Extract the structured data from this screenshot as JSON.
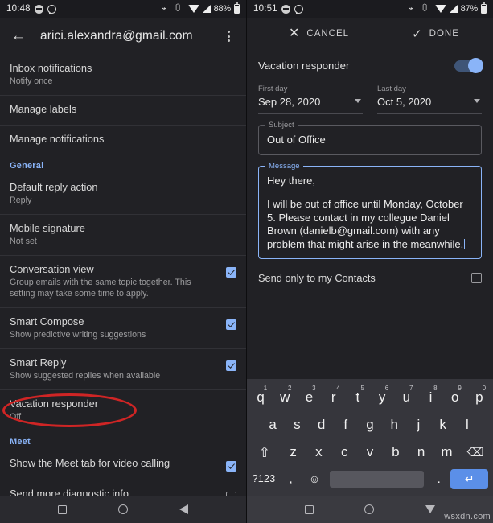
{
  "left": {
    "status": {
      "time": "10:48",
      "battery": "88%",
      "icons": [
        "message-dot-icon",
        "whatsapp-icon",
        "bluetooth-icon",
        "vibrate-icon",
        "wifi-icon",
        "signal-icon",
        "battery-icon"
      ]
    },
    "appbar": {
      "back": "back-arrow",
      "title": "arici.alexandra@gmail.com",
      "overflow": "more-options"
    },
    "rows": [
      {
        "title": "Inbox notifications",
        "subtitle": "Notify once",
        "checkbox": "none",
        "divider": false
      },
      {
        "title": "Manage labels",
        "subtitle": "",
        "checkbox": "none",
        "divider": true
      },
      {
        "title": "Manage notifications",
        "subtitle": "",
        "checkbox": "none",
        "divider": true
      },
      {
        "title": "Default reply action",
        "subtitle": "Reply",
        "checkbox": "none",
        "divider": false
      },
      {
        "title": "Mobile signature",
        "subtitle": "Not set",
        "checkbox": "none",
        "divider": true
      },
      {
        "title": "Conversation view",
        "subtitle": "Group emails with the same topic together. This setting may take some time to apply.",
        "checkbox": "checked",
        "divider": true
      },
      {
        "title": "Smart Compose",
        "subtitle": "Show predictive writing suggestions",
        "checkbox": "checked",
        "divider": true
      },
      {
        "title": "Smart Reply",
        "subtitle": "Show suggested replies when available",
        "checkbox": "checked",
        "divider": true
      },
      {
        "title": "Vacation responder",
        "subtitle": "Off",
        "checkbox": "none",
        "divider": true
      }
    ],
    "section_general": "General",
    "section_meet": "Meet",
    "meet_row": {
      "title": "Show the Meet tab for video calling",
      "checkbox": "checked"
    },
    "diagnostic_row": {
      "title": "Send more diagnostic info",
      "checkbox": "empty"
    },
    "annotation": {
      "shape": "red-ellipse",
      "color": "#cf2525",
      "target": "Vacation responder"
    },
    "nav": [
      "recents-square",
      "home-circle",
      "back-triangle"
    ]
  },
  "right": {
    "status": {
      "time": "10:51",
      "battery": "87%"
    },
    "actionbar": {
      "cancel": "CANCEL",
      "done": "DONE"
    },
    "vacation": {
      "label": "Vacation responder",
      "toggle_state": "on",
      "toggle_color": "#8ab4f8"
    },
    "first_day": {
      "caption": "First day",
      "value": "Sep 28, 2020"
    },
    "last_day": {
      "caption": "Last day",
      "value": "Oct 5, 2020"
    },
    "subject": {
      "legend": "Subject",
      "value": "Out of Office",
      "focused": false
    },
    "message": {
      "legend": "Message",
      "focused": true,
      "lines": [
        "Hey there,",
        "I will be out of office until Monday, October 5. Please contact in my collegue Daniel Brown (danielb@gmail.com) with any problem that might arise in the meanwhile."
      ]
    },
    "contacts": {
      "label": "Send only to my Contacts",
      "checkbox": "empty"
    },
    "keyboard": {
      "row1": [
        {
          "k": "q",
          "sup": "1"
        },
        {
          "k": "w",
          "sup": "2"
        },
        {
          "k": "e",
          "sup": "3"
        },
        {
          "k": "r",
          "sup": "4"
        },
        {
          "k": "t",
          "sup": "5"
        },
        {
          "k": "y",
          "sup": "6"
        },
        {
          "k": "u",
          "sup": "7"
        },
        {
          "k": "i",
          "sup": "8"
        },
        {
          "k": "o",
          "sup": "9"
        },
        {
          "k": "p",
          "sup": "0"
        }
      ],
      "row2": [
        "a",
        "s",
        "d",
        "f",
        "g",
        "h",
        "j",
        "k",
        "l"
      ],
      "row3": [
        "z",
        "x",
        "c",
        "v",
        "b",
        "n",
        "m"
      ],
      "shift": "⇧",
      "delete": "⌫",
      "sym": "?123",
      "comma": ",",
      "emoji": "☺",
      "space": "",
      "period": ".",
      "enter": "↵"
    },
    "nav": [
      "recents-square",
      "home-circle",
      "dismiss-keyboard-triangle"
    ]
  },
  "watermark": "wsxdn.com"
}
